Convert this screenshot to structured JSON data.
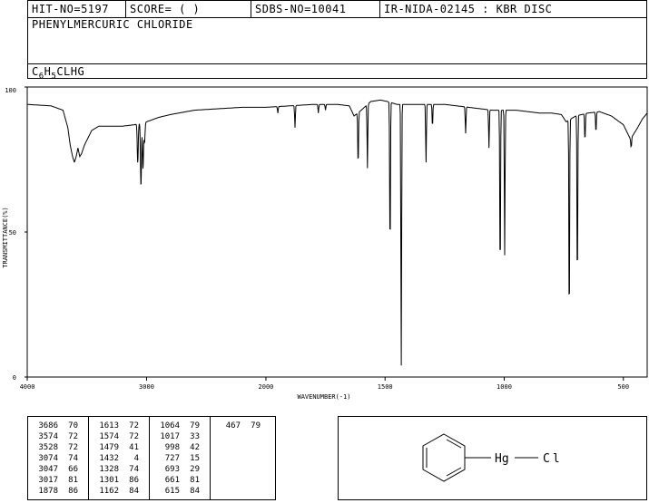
{
  "header": {
    "hit_no": "HIT-NO=5197",
    "score": "SCORE=  (   )",
    "sdbs_no": "SDBS-NO=10041",
    "ir_id": "IR-NIDA-02145 : KBR DISC",
    "compound_name": "PHENYLMERCURIC CHLORIDE",
    "formula": {
      "c": "C",
      "c_n": "6",
      "h": "H",
      "h_n": "5",
      "rest": "CLHG"
    }
  },
  "chart_data": {
    "type": "line",
    "xlabel": "WAVENUMBER(-1)",
    "ylabel": "TRANSMITTANCE(%)",
    "xlim": [
      4000,
      400
    ],
    "ylim": [
      0,
      100
    ],
    "x_ticks": [
      "4000",
      "3000",
      "2000",
      "1500",
      "1000",
      "500"
    ],
    "y_ticks": [
      "0",
      "50",
      "100"
    ],
    "grid": false,
    "baseline": [
      [
        4000,
        94
      ],
      [
        3800,
        93.5
      ],
      [
        3700,
        92
      ],
      [
        3660,
        86
      ],
      [
        3640,
        80
      ],
      [
        3620,
        76
      ],
      [
        3605,
        74
      ],
      [
        3590,
        76
      ],
      [
        3575,
        79
      ],
      [
        3560,
        76
      ],
      [
        3545,
        77
      ],
      [
        3520,
        80
      ],
      [
        3460,
        85
      ],
      [
        3400,
        86.5
      ],
      [
        3300,
        86.5
      ],
      [
        3200,
        86.5
      ],
      [
        3100,
        87
      ],
      [
        3000,
        88
      ],
      [
        2900,
        89.5
      ],
      [
        2800,
        90.5
      ],
      [
        2600,
        92
      ],
      [
        2400,
        92.5
      ],
      [
        2200,
        93
      ],
      [
        2000,
        93
      ],
      [
        1900,
        93.5
      ],
      [
        1800,
        94
      ],
      [
        1700,
        94
      ],
      [
        1650,
        93.5
      ],
      [
        1630,
        90
      ],
      [
        1600,
        92
      ],
      [
        1560,
        95
      ],
      [
        1520,
        95.5
      ],
      [
        1490,
        95
      ],
      [
        1450,
        94
      ],
      [
        1400,
        94
      ],
      [
        1350,
        94
      ],
      [
        1300,
        94
      ],
      [
        1250,
        94
      ],
      [
        1200,
        93.5
      ],
      [
        1150,
        93
      ],
      [
        1100,
        92.5
      ],
      [
        1050,
        92
      ],
      [
        1000,
        92
      ],
      [
        950,
        92
      ],
      [
        900,
        91.5
      ],
      [
        850,
        91
      ],
      [
        800,
        91
      ],
      [
        760,
        90.5
      ],
      [
        740,
        88
      ],
      [
        700,
        90
      ],
      [
        650,
        91
      ],
      [
        600,
        91.5
      ],
      [
        550,
        90
      ],
      [
        500,
        87
      ],
      [
        470,
        82
      ],
      [
        440,
        86
      ],
      [
        420,
        89
      ],
      [
        400,
        91
      ]
    ],
    "bands": [
      {
        "x": 3074,
        "y": 74
      },
      {
        "x": 3047,
        "y": 66
      },
      {
        "x": 3030,
        "y": 72
      },
      {
        "x": 3017,
        "y": 81
      },
      {
        "x": 1950,
        "y": 91
      },
      {
        "x": 1878,
        "y": 86
      },
      {
        "x": 1780,
        "y": 91
      },
      {
        "x": 1750,
        "y": 92
      },
      {
        "x": 1613,
        "y": 72
      },
      {
        "x": 1574,
        "y": 72
      },
      {
        "x": 1479,
        "y": 41
      },
      {
        "x": 1432,
        "y": 4
      },
      {
        "x": 1328,
        "y": 74
      },
      {
        "x": 1301,
        "y": 86
      },
      {
        "x": 1162,
        "y": 84
      },
      {
        "x": 1064,
        "y": 79
      },
      {
        "x": 1017,
        "y": 33
      },
      {
        "x": 998,
        "y": 42
      },
      {
        "x": 727,
        "y": 15
      },
      {
        "x": 693,
        "y": 29
      },
      {
        "x": 661,
        "y": 81
      },
      {
        "x": 615,
        "y": 84
      },
      {
        "x": 467,
        "y": 79
      }
    ]
  },
  "peak_table": [
    [
      [
        "3686",
        "70"
      ],
      [
        "3574",
        "72"
      ],
      [
        "3528",
        "72"
      ],
      [
        "3074",
        "74"
      ],
      [
        "3047",
        "66"
      ],
      [
        "3017",
        "81"
      ],
      [
        "1878",
        "86"
      ]
    ],
    [
      [
        "1613",
        "72"
      ],
      [
        "1574",
        "72"
      ],
      [
        "1479",
        "41"
      ],
      [
        "1432",
        "4"
      ],
      [
        "1328",
        "74"
      ],
      [
        "1301",
        "86"
      ],
      [
        "1162",
        "84"
      ]
    ],
    [
      [
        "1064",
        "79"
      ],
      [
        "1017",
        "33"
      ],
      [
        "998",
        "42"
      ],
      [
        "727",
        "15"
      ],
      [
        "693",
        "29"
      ],
      [
        "661",
        "81"
      ],
      [
        "615",
        "84"
      ]
    ],
    [
      [
        "467",
        "79"
      ]
    ]
  ],
  "structure": {
    "atom1": "Hg",
    "atom2": "Cl"
  }
}
